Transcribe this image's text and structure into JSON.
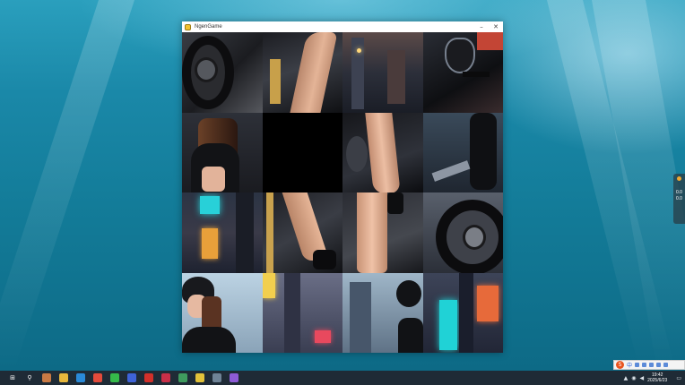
{
  "window": {
    "title": "NgenGame",
    "minimize_glyph": "–",
    "close_glyph": "✕"
  },
  "puzzle": {
    "grid_size": 4,
    "empty_tile_row": 2,
    "empty_tile_col": 2
  },
  "side_widget": {
    "readout_1": "0.0",
    "readout_2": "0.0"
  },
  "taskbar": {
    "apps": [
      {
        "name": "start",
        "glyph": "⊞",
        "color": "#1f2b36"
      },
      {
        "name": "search",
        "glyph": "⚲",
        "color": "#1f2b36"
      },
      {
        "name": "app-1",
        "glyph": "",
        "color": "#c97a44"
      },
      {
        "name": "file-explorer",
        "glyph": "",
        "color": "#e7b73c"
      },
      {
        "name": "edge",
        "glyph": "",
        "color": "#2a8ad8"
      },
      {
        "name": "chrome",
        "glyph": "",
        "color": "#e34b3b"
      },
      {
        "name": "wechat",
        "glyph": "",
        "color": "#35b94a"
      },
      {
        "name": "app-2",
        "glyph": "",
        "color": "#3e63d8"
      },
      {
        "name": "app-3",
        "glyph": "",
        "color": "#d2302a"
      },
      {
        "name": "app-4",
        "glyph": "",
        "color": "#c82f48"
      },
      {
        "name": "app-5",
        "glyph": "",
        "color": "#3f9b5e"
      },
      {
        "name": "python",
        "glyph": "",
        "color": "#e2c23a"
      },
      {
        "name": "app-6",
        "glyph": "",
        "color": "#6f8396"
      },
      {
        "name": "app-7",
        "glyph": "",
        "color": "#8d5bd6"
      }
    ],
    "clock_time": "19:42",
    "clock_date": "2025/6/23"
  },
  "ime": {
    "logo": "S",
    "label": "中"
  },
  "colors": {
    "window_bg": "#ffffff",
    "empty_tile": "#000000",
    "taskbar_bg": "#1f2b36"
  }
}
